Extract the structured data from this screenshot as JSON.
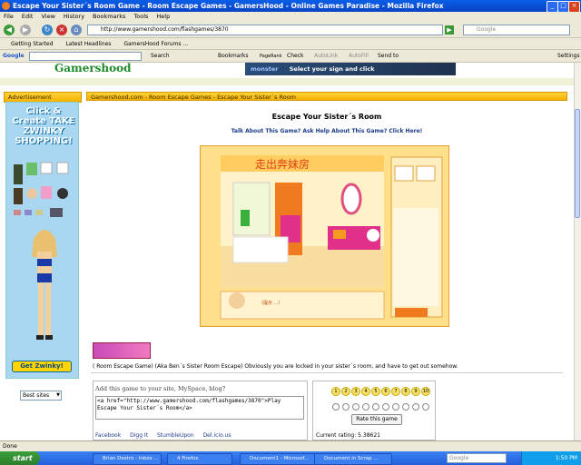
{
  "window": {
    "title": "Escape Your Sister´s Room Game - Room Escape Games - GamersHood - Online Games Paradise - Mozilla Firefox"
  },
  "menu": [
    "File",
    "Edit",
    "View",
    "History",
    "Bookmarks",
    "Tools",
    "Help"
  ],
  "nav": {
    "url": "http://www.gamershood.com/flashgames/3870",
    "search_placeholder": "Google"
  },
  "bookmarks": [
    "Getting Started",
    "Latest Headlines",
    "GamersHood Forums ..."
  ],
  "google_toolbar": {
    "label": "Google",
    "items": [
      "Search",
      "Bookmarks",
      "PageRank",
      "Check",
      "AutoLink",
      "AutoFill",
      "Send to",
      "Settings"
    ]
  },
  "site": {
    "logo": "Gamershood",
    "banner": "Select your sign and click",
    "banner_brand": "monster",
    "ad_header": "Advertisement",
    "ad_title": "Click & Create TAKE ZWINKY SHOPPING!",
    "ad_button": "Get Zwinky!",
    "best_sites": "Best sites",
    "breadcrumb": "Gamershood.com - Room Escape Games - Escape Your Sister´s Room",
    "game_title": "Escape Your Sister´s Room",
    "talk_link": "Talk About This Game? Ask Help About This Game? Click Here!",
    "description": "( Room Escape Game) (Aka Ben´s Sister Room Escape) Obviously you are locked in your sister´s room, and have to get out somehow.",
    "embed_prompt": "Add this game to your site, MySpace, blog?",
    "embed_code": "<a href=\"http://www.gamershood.com/flashgames/3870\">Play Escape Your Sister´s Room</a>",
    "social": [
      "Facebook",
      "Digg It",
      "StumbleUpon",
      "Del.icio.us"
    ],
    "rating_numbers": [
      "1",
      "2",
      "3",
      "4",
      "5",
      "6",
      "7",
      "8",
      "9",
      "10"
    ],
    "rate_button": "Rate this game",
    "current_rating": "Current rating: 5.38621"
  },
  "status": "Done",
  "taskbar": {
    "start": "start",
    "tasks": [
      "Brian Destro - Inbox ...",
      "4 Firefox",
      "Document1 - Microsof...",
      "Document in Scrap ..."
    ],
    "search": "Google",
    "clock": "1:50 PM"
  }
}
